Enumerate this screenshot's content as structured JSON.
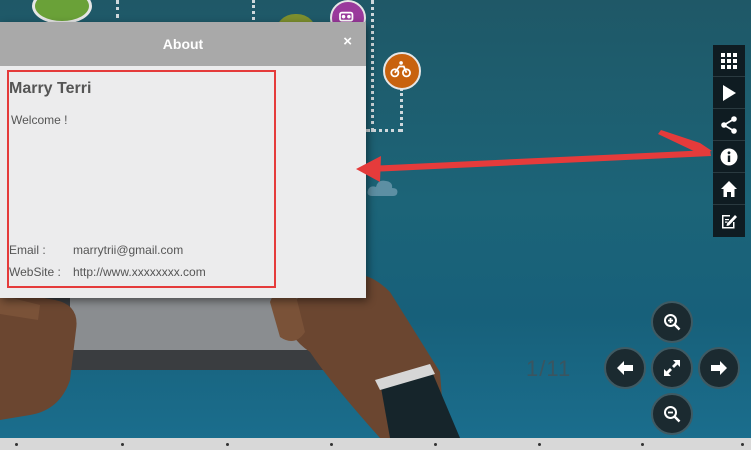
{
  "dialog": {
    "title": "About",
    "close_symbol": "×",
    "author_name": "Marry Terri",
    "welcome_text": "Welcome !",
    "email_label": "Email :",
    "email_value": "marrytrii@gmail.com",
    "website_label": "WebSite :",
    "website_value": "http://www.xxxxxxxx.com"
  },
  "toolbar": {
    "items": [
      {
        "name": "thumbnails",
        "icon": "grid-icon"
      },
      {
        "name": "play",
        "icon": "play-icon"
      },
      {
        "name": "share",
        "icon": "share-icon"
      },
      {
        "name": "info",
        "icon": "info-icon"
      },
      {
        "name": "home",
        "icon": "home-icon"
      },
      {
        "name": "edit",
        "icon": "edit-icon"
      }
    ]
  },
  "navigation": {
    "page_counter": "1/11",
    "icons": [
      "zoom-in-icon",
      "arrow-left-icon",
      "fit-screen-icon",
      "arrow-right-icon",
      "zoom-out-icon"
    ]
  },
  "colors": {
    "annotation_red": "#e53b3b",
    "dialog_header": "#a9a9a9",
    "toolbar_bg": "#0f1c22"
  }
}
